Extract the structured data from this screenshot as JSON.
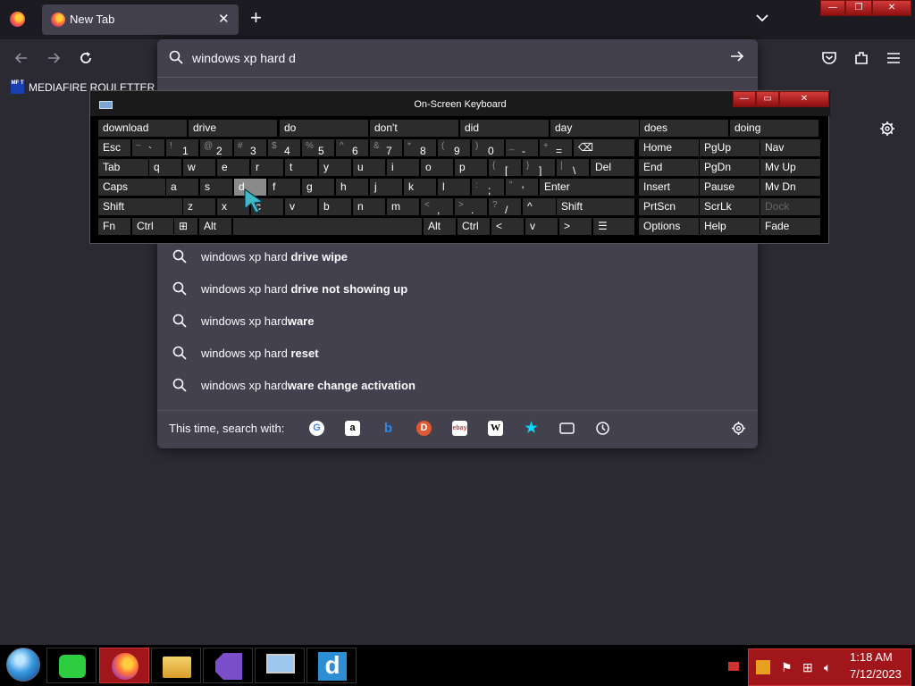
{
  "browser": {
    "tab_title": "New Tab",
    "tab_close": "✕",
    "new_tab": "+"
  },
  "urlbar": {
    "value": "windows xp hard d"
  },
  "bookmarks": {
    "item_label": "MEDIAFIRE ROULETTER",
    "item_icon_text": "MF T"
  },
  "suggestions": [
    {
      "prefix": "windows xp hard ",
      "bold": "drive wipe"
    },
    {
      "prefix": "windows xp hard ",
      "bold": "drive not showing up"
    },
    {
      "prefix": "windows xp hard",
      "bold": "ware"
    },
    {
      "prefix": "windows xp hard ",
      "bold": "reset"
    },
    {
      "prefix": "windows xp hard",
      "bold": "ware change activation"
    }
  ],
  "search_with": {
    "label": "This time, search with:",
    "engines": [
      "google-icon",
      "amazon-icon",
      "bing-icon",
      "duckduckgo-icon",
      "ebay-icon",
      "wikipedia-icon",
      "bookmarks-star-icon",
      "tabs-icon",
      "history-icon"
    ]
  },
  "osk": {
    "title": "On-Screen Keyboard",
    "predictions": [
      "download",
      "drive",
      "do",
      "don't",
      "did",
      "day",
      "does",
      "doing"
    ],
    "row1": [
      "Esc",
      "~ `",
      "! 1",
      "@ 2",
      "# 3",
      "$ 4",
      "% 5",
      "^ 6",
      "& 7",
      "* 8",
      "( 9",
      ") 0",
      "_ -",
      "+ ="
    ],
    "row2": [
      "Tab",
      "q",
      "w",
      "e",
      "r",
      "t",
      "y",
      "u",
      "i",
      "o",
      "p",
      "{ [",
      "} ]",
      "| \\",
      "Del"
    ],
    "row3": [
      "Caps",
      "a",
      "s",
      "d",
      "f",
      "g",
      "h",
      "j",
      "k",
      "l",
      ": ;",
      "\" '",
      "Enter"
    ],
    "row4": [
      "Shift",
      "z",
      "x",
      "c",
      "v",
      "b",
      "n",
      "m",
      "< ,",
      "> .",
      "? /",
      "^",
      "Shift"
    ],
    "row5": [
      "Fn",
      "Ctrl",
      "Alt",
      "Alt",
      "Ctrl",
      "<",
      "v",
      ">"
    ],
    "nav": [
      [
        "Home",
        "PgUp",
        "Nav"
      ],
      [
        "End",
        "PgDn",
        "Mv Up"
      ],
      [
        "Insert",
        "Pause",
        "Mv Dn"
      ],
      [
        "PrtScn",
        "ScrLk",
        "Dock"
      ],
      [
        "Options",
        "Help",
        "Fade"
      ]
    ]
  },
  "taskbar": {
    "time": "1:18 AM",
    "date": "7/12/2023",
    "apps": [
      "firefox-app",
      "file-explorer-app",
      "visual-studio-app",
      "remote-desktop-app",
      "d-app"
    ]
  }
}
